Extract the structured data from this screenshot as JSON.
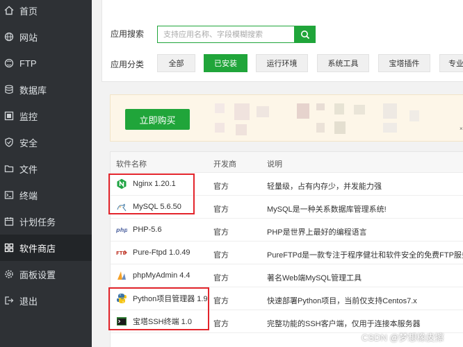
{
  "sidebar": {
    "items": [
      {
        "label": "首页",
        "icon": "home-icon"
      },
      {
        "label": "网站",
        "icon": "globe-icon"
      },
      {
        "label": "FTP",
        "icon": "ftp-globe-icon"
      },
      {
        "label": "数据库",
        "icon": "database-icon"
      },
      {
        "label": "监控",
        "icon": "monitor-icon"
      },
      {
        "label": "安全",
        "icon": "shield-icon"
      },
      {
        "label": "文件",
        "icon": "folder-icon"
      },
      {
        "label": "终端",
        "icon": "terminal-icon"
      },
      {
        "label": "计划任务",
        "icon": "calendar-icon"
      },
      {
        "label": "软件商店",
        "icon": "grid-icon",
        "active": true
      },
      {
        "label": "面板设置",
        "icon": "gear-icon"
      },
      {
        "label": "退出",
        "icon": "logout-icon"
      }
    ]
  },
  "search": {
    "label": "应用搜索",
    "placeholder": "支持应用名称、字段模糊搜索",
    "value": ""
  },
  "categories": {
    "label": "应用分类",
    "tabs": [
      "全部",
      "已安装",
      "运行环境",
      "系统工具",
      "宝塔插件",
      "专业"
    ],
    "active": "已安装"
  },
  "banner": {
    "buy_label": "立即购买",
    "close_glyph": "×"
  },
  "table": {
    "headers": [
      "软件名称",
      "开发商",
      "说明"
    ],
    "rows": [
      {
        "name": "Nginx 1.20.1",
        "vendor": "官方",
        "desc": "轻量级，占有内存少，并发能力强",
        "icon": "nginx-icon"
      },
      {
        "name": "MySQL 5.6.50",
        "vendor": "官方",
        "desc": "MySQL是一种关系数据库管理系统!",
        "icon": "mysql-icon"
      },
      {
        "name": "PHP-5.6",
        "vendor": "官方",
        "desc": "PHP是世界上最好的编程语言",
        "icon": "php-icon"
      },
      {
        "name": "Pure-Ftpd 1.0.49",
        "vendor": "官方",
        "desc": "PureFTPd是一款专注于程序健壮和软件安全的免费FTP服务器软",
        "icon": "ftpd-icon"
      },
      {
        "name": "phpMyAdmin 4.4",
        "vendor": "官方",
        "desc": "著名Web端MySQL管理工具",
        "icon": "phpmyadmin-icon"
      },
      {
        "name": "Python项目管理器 1.9",
        "vendor": "官方",
        "desc": "快速部署Python项目，当前仅支持Centos7.x",
        "icon": "python-icon"
      },
      {
        "name": "宝塔SSH终端 1.0",
        "vendor": "官方",
        "desc": "完整功能的SSH客户端，仅用于连接本服务器",
        "icon": "ssh-terminal-icon"
      }
    ]
  },
  "watermark": "CSDN @梦想橡皮擦",
  "colors": {
    "accent": "#20a53a",
    "sidebar_bg": "#2e3135",
    "highlight": "#e3242b"
  }
}
